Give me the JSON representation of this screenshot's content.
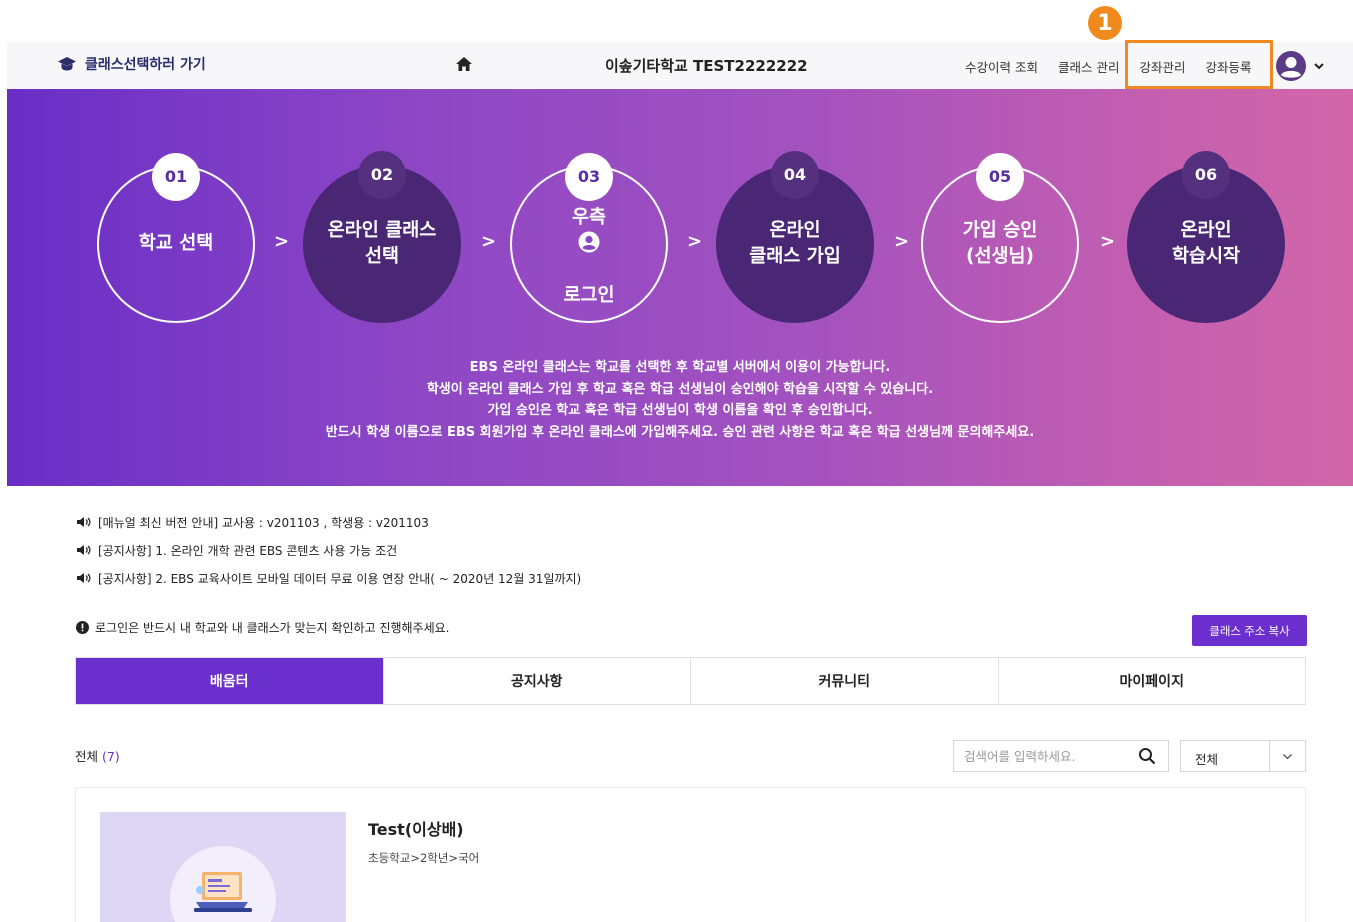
{
  "header": {
    "back_label": "클래스선택하러 가기",
    "school_name": "이솦기타학교 TEST2222222",
    "nav": [
      "수강이력 조회",
      "클래스 관리",
      "강좌관리",
      "강좌등록"
    ]
  },
  "annotation": {
    "badge": "1",
    "color": "#ef8a22"
  },
  "hero": {
    "steps": [
      {
        "num": "01",
        "label": "학교 선택",
        "style": "outline"
      },
      {
        "num": "02",
        "label": "온라인 클래스\n선택",
        "style": "filled"
      },
      {
        "num": "03",
        "label_top": "우측",
        "label_bottom": "로그인",
        "icon": "person-circle-icon",
        "style": "outline"
      },
      {
        "num": "04",
        "label": "온라인\n클래스 가입",
        "style": "filled"
      },
      {
        "num": "05",
        "label": "가입 승인\n(선생님)",
        "style": "outline"
      },
      {
        "num": "06",
        "label": "온라인\n학습시작",
        "style": "filled"
      }
    ],
    "arrow": ">",
    "lines": [
      "EBS 온라인 클래스는 학교를 선택한 후 학교별 서버에서 이용이 가능합니다.",
      "학생이 온라인 클래스 가입 후 학교 혹은 학급 선생님이 승인해야 학습을 시작할 수 있습니다.",
      "가입 승인은 학교 혹은 학급 선생님이 학생 이름을 확인 후 승인합니다.",
      "반드시 학생 이름으로 EBS 회원가입 후 온라인 클래스에 가입해주세요. 승인 관련 사항은 학교 혹은 학급 선생님께 문의해주세요."
    ]
  },
  "notices": [
    "[매뉴얼 최신 버전 안내] 교사용 : v201103 , 학생용 : v201103",
    "[공지사항] 1. 온라인 개학 관련 EBS 콘텐츠 사용 가능 조건",
    "[공지사항] 2. EBS 교육사이트 모바일 데이터 무료 이용 연장 안내( ~ 2020년 12월 31일까지)"
  ],
  "login_notice": "로그인은 반드시 내 학교와 내 클래스가 맞는지 확인하고 진행해주세요.",
  "copy_button": "클래스 주소 복사",
  "tabs": [
    "배움터",
    "공지사항",
    "커뮤니티",
    "마이페이지"
  ],
  "list": {
    "total_label": "전체",
    "total_count": "(7)",
    "search_placeholder": "검색어를 입력하세요.",
    "filter_value": "전체"
  },
  "card": {
    "title": "Test(이상배)",
    "subtitle": "초등학교>2학년>국어"
  },
  "colors": {
    "accent": "#6b2fce",
    "dark_step": "#4a2774",
    "highlight": "#ef8a22"
  }
}
